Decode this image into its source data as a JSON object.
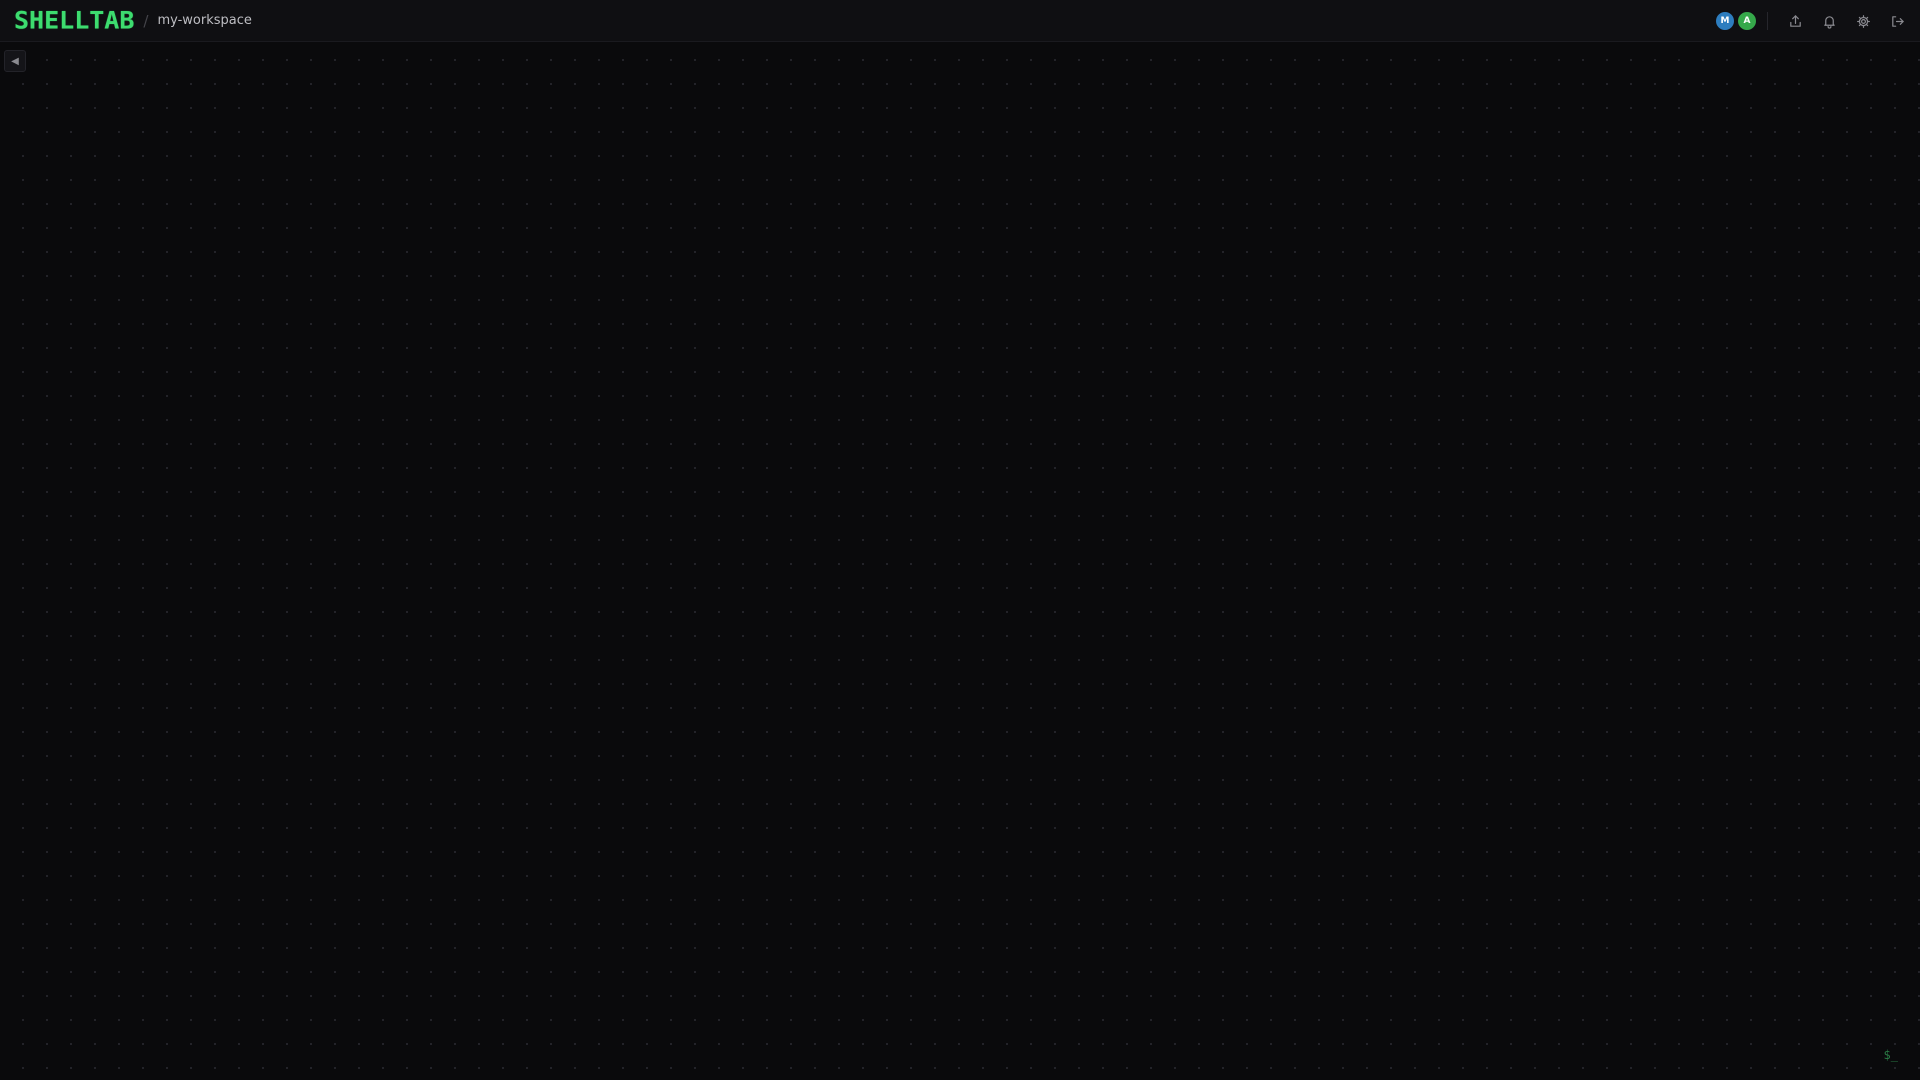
{
  "header": {
    "logo_text": "SHELLTAB",
    "separator": "/",
    "workspace_name": "my-workspace"
  },
  "collaborators": [
    {
      "initial": "M",
      "color": "#2d7dbf"
    },
    {
      "initial": "A",
      "color": "#35a84a"
    }
  ],
  "toolbar": {
    "icons": [
      "share-icon",
      "bell-icon",
      "gear-icon",
      "logout-icon"
    ]
  },
  "sidebar": {
    "collapse_glyph": "◀"
  },
  "footer": {
    "prompt_text": "$_"
  },
  "colors": {
    "accent": "#3ddc6f",
    "background": "#0a0a0c",
    "topbar": "#0f0f12"
  }
}
